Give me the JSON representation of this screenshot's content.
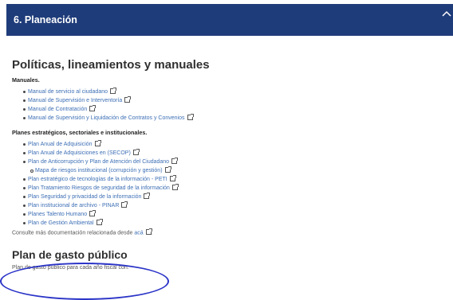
{
  "header": {
    "title": "6. Planeación"
  },
  "section": {
    "title": "Políticas, lineamientos y manuales",
    "manuales_label": "Manuales.",
    "manuales": [
      "Manual de servicio al ciudadano",
      "Manual de Supervisión e Interventoría",
      "Manual de Contratación",
      "Manual de Supervisión y Liquidación de Contratos y Convenios"
    ],
    "planes_label": "Planes estratégicos, sectoriales e institucionales.",
    "planes": [
      "Plan Anual de Adquisición",
      "Plan Anual de Adquisiciones en (SECOP)",
      "Plan de Anticorrupción y Plan de Atención del Ciudadano",
      "Mapa de riesgos institucional (corrupción y gestión)",
      "Plan estratégico de tecnologías de la información - PETI",
      "Plan Tratamiento Riesgos de seguridad de la información",
      "Plan Seguridad y privacidad de la información",
      "Plan institucional de archivo - PINAR",
      "Planes Talento Humano",
      "Plan de Gestión Ambiental"
    ],
    "note_prefix": "Consulte más documentación relacionada desde",
    "note_link": "acá"
  },
  "gasto": {
    "title": "Plan de gasto público",
    "desc": "Plan de gasto público para cada año fiscal con:"
  },
  "colors": {
    "header_bg": "#1f3c7a",
    "link": "#3d6fb5",
    "annotation": "#2b34c7"
  }
}
